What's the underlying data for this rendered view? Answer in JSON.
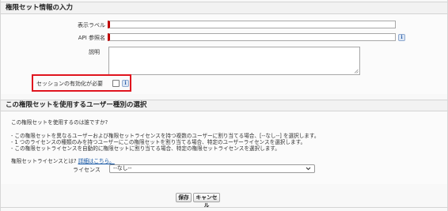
{
  "section1": {
    "title": "権限セット情報の入力",
    "label_field_label": "表示ラベル",
    "label_field_value": "",
    "api_name_label": "API 参照名",
    "api_name_value": "",
    "description_label": "説明",
    "description_value": "",
    "session_label": "セッションの有効化が必要",
    "info_glyph": "i"
  },
  "section2": {
    "title": "この権限セットを使用するユーザー種別の選択",
    "question": "この権限セットを使用するのは誰ですか?",
    "bullet1": "- この権限セットを異なるユーザーおよび権限セットライセンスを持つ複数のユーザーに割り当てる場合、[--なし--] を選択します。",
    "bullet2": "- 1 つのライセンスの種類のみを持つユーザーにこの権限セットを割り当てる場合、特定のユーザーライセンスを選択します。",
    "bullet3": "- この権限セットライセンスを自動的に権限セットに割り当てる場合、特定の権限セットライセンスを選択します。",
    "psl_question": "権限セットライセンスとは?",
    "psl_link": "詳細はこちら。",
    "license_label": "ライセンス",
    "license_selected": "--なし--"
  },
  "buttons": {
    "save": "保存",
    "cancel": "キャンセル"
  },
  "icons": {
    "info": "info-icon",
    "chevron": "chevron-down-icon",
    "grip": "resize-grip-icon"
  },
  "colors": {
    "required_bar": "#c00000",
    "highlight": "#e0141e",
    "link": "#0b4fa0"
  }
}
